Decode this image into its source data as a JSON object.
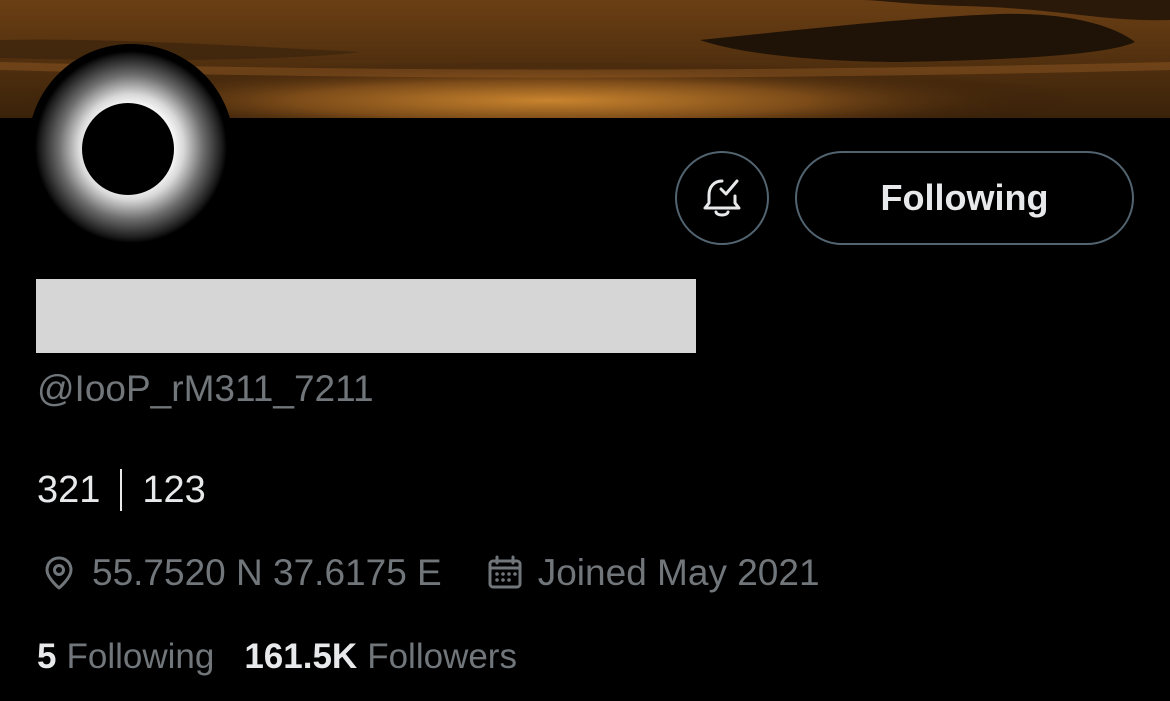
{
  "profile": {
    "handle": "@IooP_rM311_7211",
    "bio": {
      "left": "321",
      "right": "123"
    },
    "location": "55.7520 N 37.6175 E",
    "joined": "Joined May 2021",
    "following_count": "5",
    "following_label": "Following",
    "followers_count": "161.5K",
    "followers_label": "Followers"
  },
  "actions": {
    "follow_state_label": "Following",
    "notifications_icon": "bell-check-icon"
  },
  "icons": {
    "location": "location-pin-icon",
    "calendar": "calendar-icon"
  },
  "colors": {
    "background": "#000000",
    "primary_text": "#e7e9ea",
    "secondary_text": "#71767b",
    "button_border": "#536471",
    "redaction": "#d6d6d6"
  }
}
